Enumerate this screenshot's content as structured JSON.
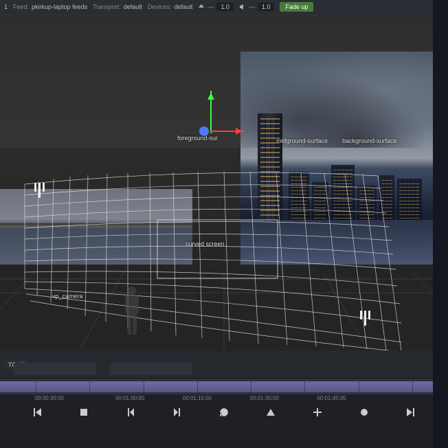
{
  "topbar": {
    "id_label": "1",
    "feed_label": "Feed:",
    "feed_value": "pkirkup-laptop feeds",
    "transport_label": "Transport:",
    "transport_value": "default",
    "devices_label": "Devices:",
    "devices_value": "default",
    "speed_value": "1.0",
    "volume_value": "1.0",
    "fadeup_label": "Fade up"
  },
  "scene": {
    "labels": {
      "foreground": "foreground-sur",
      "midground": "midground-surface",
      "background": "background-surface",
      "screen": "curved screen",
      "camera": "vp_camera"
    }
  },
  "timeline": {
    "tc_label": "TC 30",
    "marks": [
      "00:00:30:00",
      "00:01:00:00",
      "00:01:15:00",
      "00:01:30:00",
      "00:01:45:00"
    ]
  }
}
